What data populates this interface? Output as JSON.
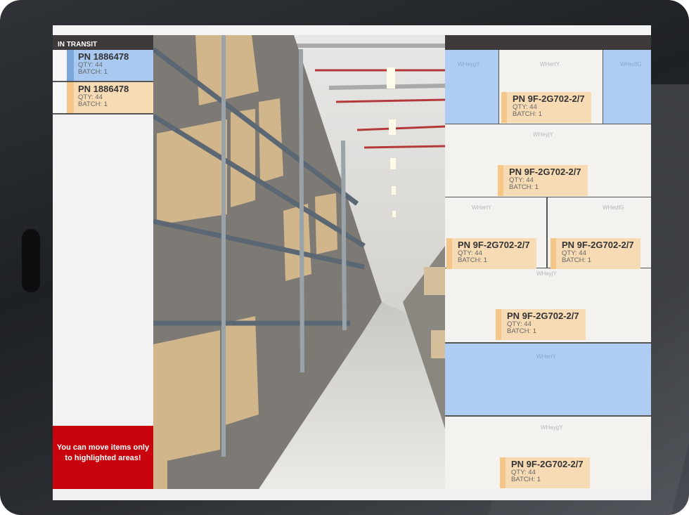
{
  "left_panel": {
    "header": "IN TRANSIT",
    "items": [
      {
        "pn": "PN 1886478",
        "qty": "QTY: 44",
        "batch": "BATCH: 1",
        "color": "#a9c9f0",
        "bar_color": "#7ba7dd"
      },
      {
        "pn": "PN 1886478",
        "qty": "QTY: 44",
        "batch": "BATCH: 1",
        "color": "#f7dbb5",
        "bar_color": "#f4c687"
      }
    ],
    "warning": "You can move items only to highlighted areas!"
  },
  "zones": [
    {
      "label": "WHeygY",
      "highlighted": true
    },
    {
      "label": "WHertY",
      "highlighted": false
    },
    {
      "label": "WHedfG",
      "highlighted": true
    },
    {
      "label": "WHeyjY",
      "highlighted": false
    },
    {
      "label": "WHertY",
      "highlighted": false
    },
    {
      "label": "WHedfG",
      "highlighted": false
    },
    {
      "label": "WHeyjY",
      "highlighted": false
    },
    {
      "label": "WHertY",
      "highlighted": true
    },
    {
      "label": "WHeygY",
      "highlighted": false
    }
  ],
  "cards": [
    {
      "pn": "PN 9F-2G702-2/7",
      "qty": "QTY: 44",
      "batch": "BATCH: 1"
    },
    {
      "pn": "PN 9F-2G702-2/7",
      "qty": "QTY: 44",
      "batch": "BATCH: 1"
    },
    {
      "pn": "PN 9F-2G702-2/7",
      "qty": "QTY: 44",
      "batch": "BATCH: 1"
    },
    {
      "pn": "PN 9F-2G702-2/7",
      "qty": "QTY: 44",
      "batch": "BATCH: 1"
    },
    {
      "pn": "PN 9F-2G702-2/7",
      "qty": "QTY: 44",
      "batch": "BATCH: 1"
    },
    {
      "pn": "PN 9F-2G702-2/7",
      "qty": "QTY: 44",
      "batch": "BATCH: 1"
    }
  ],
  "colors": {
    "highlight": "#afcdf3",
    "card": "#f7dbb5",
    "warning": "#c8040c",
    "header": "#3e3a3b"
  }
}
